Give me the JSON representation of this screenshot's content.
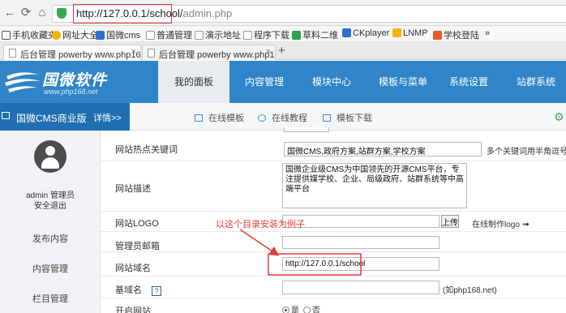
{
  "browser": {
    "url_host": "http://127.0.0.1/school/",
    "url_path": "admin.php",
    "bookmarks": [
      "手机收藏夹",
      "网址大全",
      "国微cms",
      "普通管理",
      "演示地址",
      "程序下载",
      "草料二维",
      "CKplayer",
      "LNMP",
      "学校登陆",
      "»"
    ],
    "tabs": [
      {
        "label": "后台管理 powerby www.php16",
        "close": "×"
      },
      {
        "label": "后台管理 powerby www.php16",
        "close": "×"
      }
    ],
    "new_tab": "+"
  },
  "header": {
    "logo_title": "国微软件",
    "logo_sub": "www.php168.net",
    "nav": [
      "我的面板",
      "内容管理",
      "模块中心",
      "模板与菜单",
      "系统设置",
      "站群系统"
    ]
  },
  "subbar": {
    "edition": "国微CMS商业版",
    "details": "详情>>",
    "links": [
      "在线模板",
      "在线教程",
      "模板下载"
    ]
  },
  "sidebar": {
    "user": "admin 管理员",
    "logout": "安全退出",
    "items": [
      "发布内容",
      "内容管理",
      "栏目管理"
    ]
  },
  "form": {
    "keywords_label": "网站热点关键词",
    "keywords_value": "国微CMS,政府方案,站群方案,学校方案",
    "keywords_hint": "多个关键词用半角逗号\",\"",
    "desc_label": "网站描述",
    "desc_value": "国微企业级CMS为中国领先的开源CMS平台，专注提供媒学校、企业、局级政府、站群系统等中高端平台",
    "logo_label": "网站LOGO",
    "upload_label": "上传",
    "online_logo": "在线制作logo",
    "email_label": "管理员邮箱",
    "domain_label": "网站域名",
    "domain_value": "http://127.0.0.1/school",
    "base_domain_label": "基域名",
    "base_domain_help": "?",
    "base_domain_hint": "(如php168.net)",
    "open_label": "开启网站",
    "yes": "是",
    "no": "否"
  },
  "annotation": "以这个目录安装为例子",
  "colors": {
    "header_blue": "#2f85c8",
    "edition_blue": "#1f6fb2",
    "annotation_red": "#e23a3a"
  }
}
